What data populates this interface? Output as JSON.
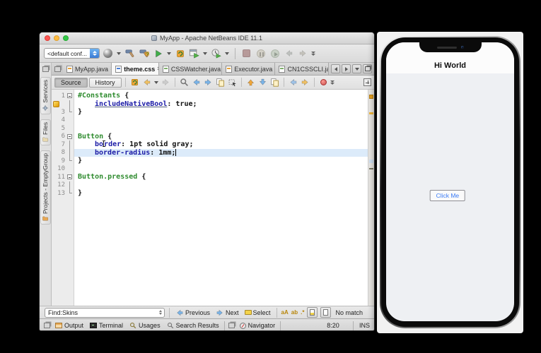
{
  "colors": {
    "selector-green": "#2e8b2e",
    "property-blue": "#1a1aa6",
    "current-line-blue": "#dcebfa",
    "warning-orange": "#e8a321",
    "run-green": "#3fae49",
    "stop-red": "#c75450",
    "button-text-blue": "#3a7bf6"
  },
  "titlebar": {
    "title": "MyApp - Apache NetBeans IDE 11.1"
  },
  "toolbar": {
    "config_combo": "<default conf..."
  },
  "rail": {
    "services": "Services",
    "files": "Files",
    "projects": "Projects - EmptyGroup"
  },
  "doc_tabs": {
    "tabs": [
      {
        "label": "MyApp.java"
      },
      {
        "label": "theme.css"
      },
      {
        "label": "CSSWatcher.java"
      },
      {
        "label": "Executor.java"
      },
      {
        "label": "CN1CSSCLI.ja."
      }
    ]
  },
  "editor_toolbar": {
    "source": "Source",
    "history": "History"
  },
  "code": {
    "line_numbers": [
      "1",
      "",
      "3",
      "4",
      "5",
      "6",
      "7",
      "8",
      "9",
      "10",
      "11",
      "12",
      "13"
    ],
    "l1": {
      "selector": "#Constants",
      "brace": " {"
    },
    "l2": {
      "property": "includeNativeBool",
      "value": ": true;"
    },
    "l3": {
      "brace": "}"
    },
    "l6": {
      "selector": "Button",
      "brace": " {"
    },
    "l7": {
      "property_a": "bo",
      "property_b": "rder",
      "value": ": 1pt solid gray;"
    },
    "l8": {
      "property": "border-radius",
      "value": ": 1mm;"
    },
    "l9": {
      "brace": "}"
    },
    "l11": {
      "selector": "Button.pressed",
      "brace": " {"
    },
    "l13": {
      "brace": "}"
    }
  },
  "find_bar": {
    "query": "Find:Skins",
    "previous": "Previous",
    "next": "Next",
    "select": "Select",
    "match_case": "aA",
    "whole_words": "ab",
    "regex": ".*",
    "status": "No match"
  },
  "status_bar": {
    "output": "Output",
    "terminal": "Terminal",
    "usages": "Usages",
    "search_results": "Search Results",
    "navigator": "Navigator",
    "caret_position": "8:20",
    "insert_mode": "INS"
  },
  "phone": {
    "app_title": "Hi World",
    "button_label": "Click Me"
  },
  "icons": {
    "close": "×"
  }
}
